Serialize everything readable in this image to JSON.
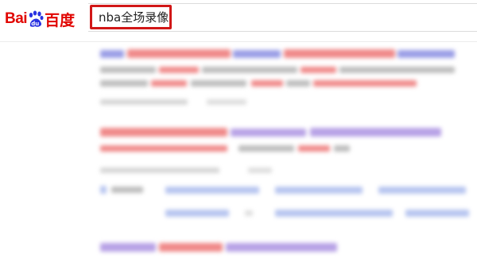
{
  "header": {
    "logo": {
      "text_left": "Bai",
      "text_mid": "du",
      "text_right": "百度",
      "paw_icon": "baidu-paw-icon",
      "brand_red": "#e10602",
      "brand_blue": "#2932e1"
    },
    "search": {
      "query": "nba全场录像",
      "highlight_color": "#d11717"
    }
  }
}
